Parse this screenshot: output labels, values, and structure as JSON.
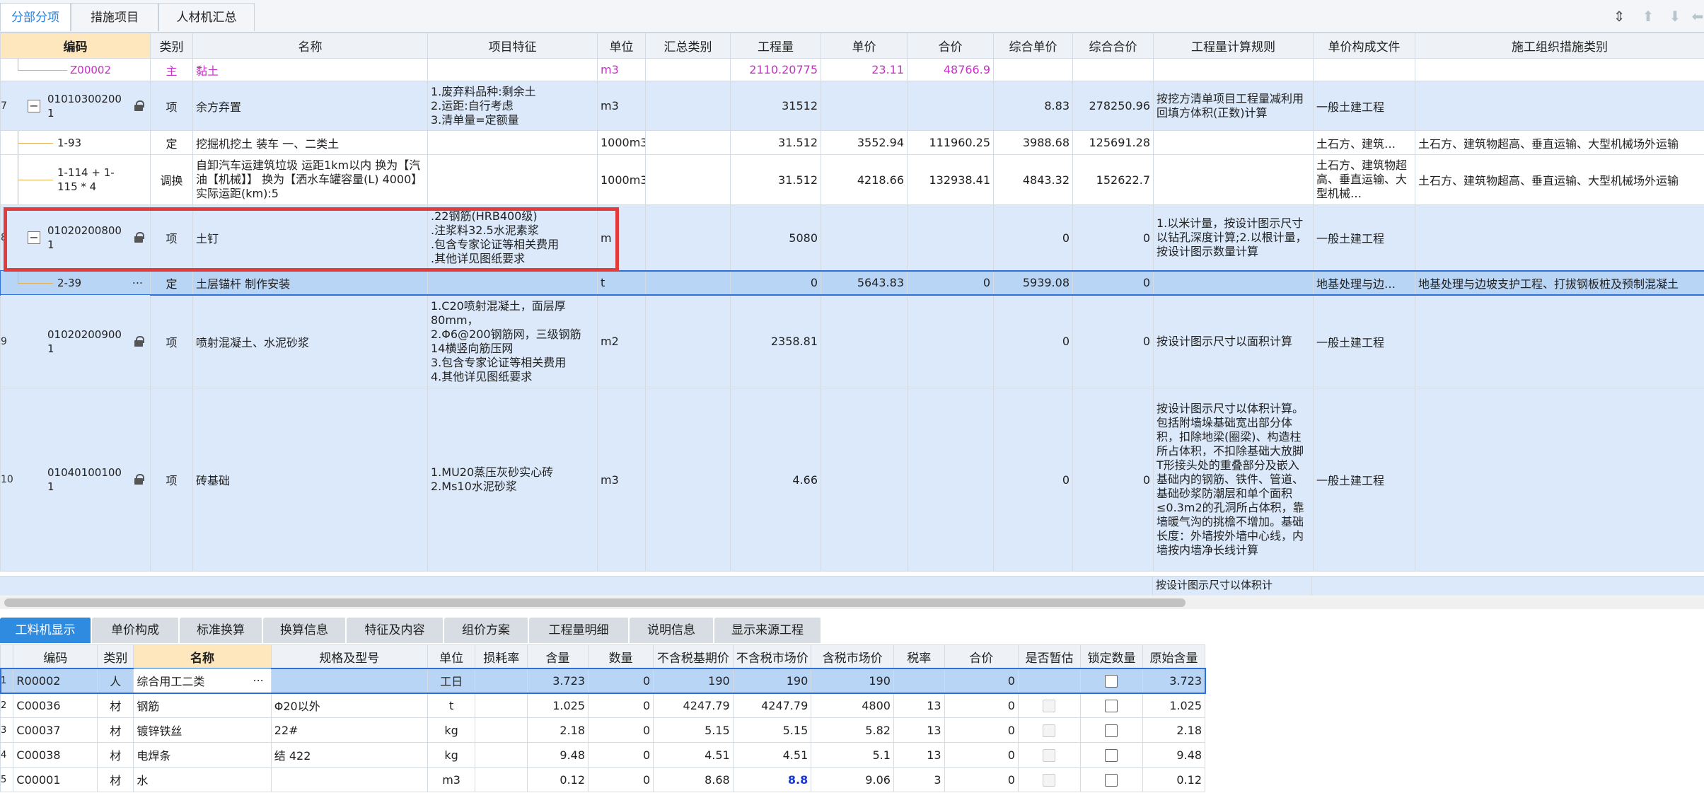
{
  "top_tabs": [
    {
      "label": "分部分项",
      "active": true
    },
    {
      "label": "措施项目",
      "active": false
    },
    {
      "label": "人材机汇总",
      "active": false
    }
  ],
  "main_headers": [
    "编码",
    "类别",
    "名称",
    "项目特征",
    "单位",
    "汇总类别",
    "工程量",
    "单价",
    "合价",
    "综合单价",
    "综合合价",
    "工程量计算规则",
    "单价构成文件",
    "施工组织措施类别"
  ],
  "main_rows": [
    {
      "num": "",
      "code": "Z00002",
      "type": "主",
      "name": "黏土",
      "feature": "",
      "unit": "m3",
      "qty": "2110.20775",
      "price": "23.11",
      "total": "48766.9",
      "comp_price": "",
      "comp_total": "",
      "rule": "",
      "file": "",
      "measure": ""
    },
    {
      "num": "7",
      "code": "01010300200 1",
      "type": "项",
      "name": "余方弃置",
      "feature": "1.废弃料品种:剩余土\n2.运距:自行考虑\n3.清单量=定额量",
      "unit": "m3",
      "qty": "31512",
      "price": "",
      "total": "",
      "comp_price": "8.83",
      "comp_total": "278250.96",
      "rule": "按挖方清单项目工程量减利用回填方体积(正数)计算",
      "file": "一般土建工程",
      "measure": ""
    },
    {
      "num": "",
      "code": "1-93",
      "type": "定",
      "name": "挖掘机挖土 装车 一、二类土",
      "feature": "",
      "unit": "1000m3",
      "qty": "31.512",
      "price": "3552.94",
      "total": "111960.25",
      "comp_price": "3988.68",
      "comp_total": "125691.28",
      "rule": "",
      "file": "土石方、建筑…",
      "measure": "土石方、建筑物超高、垂直运输、大型机械场外运输"
    },
    {
      "num": "",
      "code": "1-114 + 1-115 * 4",
      "type": "调换",
      "name": "自卸汽车运建筑垃圾 运距1km以内  换为【汽油【机械】】  换为【洒水车罐容量(L) 4000】  实际运距(km):5",
      "feature": "",
      "unit": "1000m3",
      "qty": "31.512",
      "price": "4218.66",
      "total": "132938.41",
      "comp_price": "4843.32",
      "comp_total": "152622.7",
      "rule": "",
      "file": "土石方、建筑物超高、垂直运输、大型机械…",
      "measure": "土石方、建筑物超高、垂直运输、大型机械场外运输"
    },
    {
      "num": "8",
      "code": "01020200800 1",
      "type": "项",
      "name": "土钉",
      "feature": ".22钢筋(HRB400级)\n.注浆料32.5水泥素浆\n.包含专家论证等相关费用\n.其他详见图纸要求",
      "unit": "m",
      "qty": "5080",
      "price": "",
      "total": "",
      "comp_price": "0",
      "comp_total": "0",
      "rule": "1.以米计量，按设计图示尺寸以钻孔深度计算;2.以根计量，按设计图示数量计算",
      "file": "一般土建工程",
      "measure": ""
    },
    {
      "num": "",
      "code": "2-39",
      "type": "定",
      "name": "土层锚杆 制作安装",
      "feature": "",
      "unit": "t",
      "qty": "0",
      "price": "5643.83",
      "total": "0",
      "comp_price": "5939.08",
      "comp_total": "0",
      "rule": "",
      "file": "地基处理与边…",
      "measure": "地基处理与边坡支护工程、打拔钢板桩及预制混凝土"
    },
    {
      "num": "9",
      "code": "01020200900 1",
      "type": "项",
      "name": "喷射混凝土、水泥砂浆",
      "feature": "1.C20喷射混凝土，面层厚80mm，\n2.Φ6@200钢筋网，三级钢筋14横竖向筋压网\n3.包含专家论证等相关费用\n4.其他详见图纸要求",
      "unit": "m2",
      "qty": "2358.81",
      "price": "",
      "total": "",
      "comp_price": "0",
      "comp_total": "0",
      "rule": "按设计图示尺寸以面积计算",
      "file": "一般土建工程",
      "measure": ""
    },
    {
      "num": "10",
      "code": "01040100100 1",
      "type": "项",
      "name": "砖基础",
      "feature": "1.MU20蒸压灰砂实心砖\n2.Ms10水泥砂浆",
      "unit": "m3",
      "qty": "4.66",
      "price": "",
      "total": "",
      "comp_price": "0",
      "comp_total": "0",
      "rule": "按设计图示尺寸以体积计算。包括附墙垛基础宽出部分体积，扣除地梁(圈梁)、构造柱所占体积，不扣除基础大放脚T形接头处的重叠部分及嵌入基础内的钢筋、铁件、管道、基础砂浆防潮层和单个面积≤0.3m2的孔洞所占体积，靠墙暖气沟的挑檐不增加。基础长度：外墙按外墙中心线，内墙按内墙净长线计算",
      "file": "一般土建工程",
      "measure": ""
    },
    {
      "num": "",
      "code": "",
      "type": "",
      "name": "",
      "feature": "",
      "unit": "",
      "qty": "",
      "price": "",
      "total": "",
      "comp_price": "",
      "comp_total": "",
      "rule": "按设计图示尺寸以体积计",
      "file": "",
      "measure": ""
    }
  ],
  "bottom_tabs": [
    {
      "label": "工料机显示",
      "active": true
    },
    {
      "label": "单价构成",
      "active": false
    },
    {
      "label": "标准换算",
      "active": false
    },
    {
      "label": "换算信息",
      "active": false
    },
    {
      "label": "特征及内容",
      "active": false
    },
    {
      "label": "组价方案",
      "active": false
    },
    {
      "label": "工程量明细",
      "active": false
    },
    {
      "label": "说明信息",
      "active": false
    },
    {
      "label": "显示来源工程",
      "active": false
    }
  ],
  "sub_headers": [
    "编码",
    "类别",
    "名称",
    "规格及型号",
    "单位",
    "损耗率",
    "含量",
    "数量",
    "不含税基期价",
    "不含税市场价",
    "含税市场价",
    "税率",
    "合价",
    "是否暂估",
    "锁定数量",
    "原始含量"
  ],
  "sub_rows": [
    {
      "num": "1",
      "code": "R00002",
      "type": "人",
      "name": "综合用工二类",
      "spec": "",
      "unit": "工日",
      "loss": "",
      "content": "3.723",
      "qty": "0",
      "base_price": "190",
      "market_price": "190",
      "tax_price": "190",
      "tax_rate": "",
      "total": "0",
      "estimate": "",
      "locked": false,
      "orig": "3.723"
    },
    {
      "num": "2",
      "code": "C00036",
      "type": "材",
      "name": "钢筋",
      "spec": "Φ20以外",
      "unit": "t",
      "loss": "",
      "content": "1.025",
      "qty": "0",
      "base_price": "4247.79",
      "market_price": "4247.79",
      "tax_price": "4800",
      "tax_rate": "13",
      "total": "0",
      "estimate": "disabled",
      "locked": false,
      "orig": "1.025"
    },
    {
      "num": "3",
      "code": "C00037",
      "type": "材",
      "name": "镀锌铁丝",
      "spec": "22#",
      "unit": "kg",
      "loss": "",
      "content": "2.18",
      "qty": "0",
      "base_price": "5.15",
      "market_price": "5.15",
      "tax_price": "5.82",
      "tax_rate": "13",
      "total": "0",
      "estimate": "disabled",
      "locked": false,
      "orig": "2.18"
    },
    {
      "num": "4",
      "code": "C00038",
      "type": "材",
      "name": "电焊条",
      "spec": "结 422",
      "unit": "kg",
      "loss": "",
      "content": "9.48",
      "qty": "0",
      "base_price": "4.51",
      "market_price": "4.51",
      "tax_price": "5.1",
      "tax_rate": "13",
      "total": "0",
      "estimate": "disabled",
      "locked": false,
      "orig": "9.48"
    },
    {
      "num": "5",
      "code": "C00001",
      "type": "材",
      "name": "水",
      "spec": "",
      "unit": "m3",
      "loss": "",
      "content": "0.12",
      "qty": "0",
      "base_price": "8.68",
      "market_price": "8.8",
      "tax_price": "9.06",
      "tax_rate": "3",
      "total": "0",
      "estimate": "disabled",
      "locked": false,
      "orig": "0.12"
    }
  ],
  "icons": [
    "column-settings-icon",
    "move-up-icon",
    "move-down-icon",
    "move-left-icon",
    "lock-icon",
    "collapse-icon",
    "more-icon"
  ],
  "colors": {
    "accent": "#2f8be0",
    "highlight_box": "#e23b3b",
    "item_row": "#dbe9fb",
    "selected_row": "#b9d5f6",
    "material_text": "#c531c5"
  }
}
